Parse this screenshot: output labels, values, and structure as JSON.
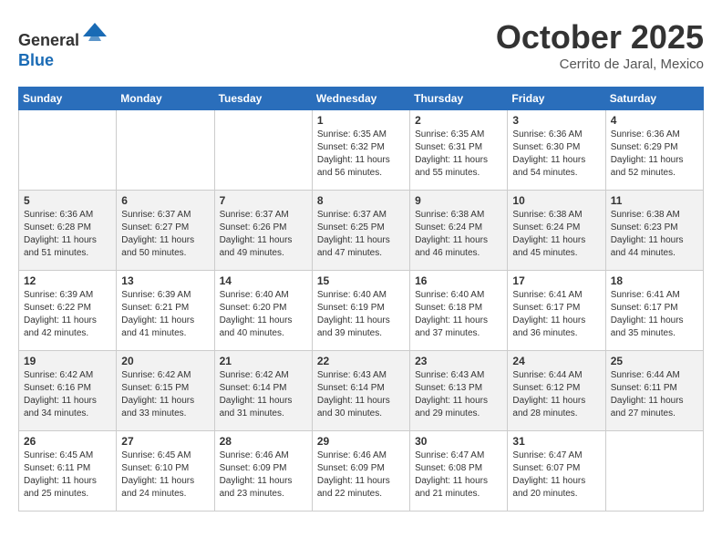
{
  "header": {
    "logo_line1": "General",
    "logo_line2": "Blue",
    "month": "October 2025",
    "location": "Cerrito de Jaral, Mexico"
  },
  "weekdays": [
    "Sunday",
    "Monday",
    "Tuesday",
    "Wednesday",
    "Thursday",
    "Friday",
    "Saturday"
  ],
  "weeks": [
    [
      {
        "day": "",
        "info": ""
      },
      {
        "day": "",
        "info": ""
      },
      {
        "day": "",
        "info": ""
      },
      {
        "day": "1",
        "info": "Sunrise: 6:35 AM\nSunset: 6:32 PM\nDaylight: 11 hours\nand 56 minutes."
      },
      {
        "day": "2",
        "info": "Sunrise: 6:35 AM\nSunset: 6:31 PM\nDaylight: 11 hours\nand 55 minutes."
      },
      {
        "day": "3",
        "info": "Sunrise: 6:36 AM\nSunset: 6:30 PM\nDaylight: 11 hours\nand 54 minutes."
      },
      {
        "day": "4",
        "info": "Sunrise: 6:36 AM\nSunset: 6:29 PM\nDaylight: 11 hours\nand 52 minutes."
      }
    ],
    [
      {
        "day": "5",
        "info": "Sunrise: 6:36 AM\nSunset: 6:28 PM\nDaylight: 11 hours\nand 51 minutes."
      },
      {
        "day": "6",
        "info": "Sunrise: 6:37 AM\nSunset: 6:27 PM\nDaylight: 11 hours\nand 50 minutes."
      },
      {
        "day": "7",
        "info": "Sunrise: 6:37 AM\nSunset: 6:26 PM\nDaylight: 11 hours\nand 49 minutes."
      },
      {
        "day": "8",
        "info": "Sunrise: 6:37 AM\nSunset: 6:25 PM\nDaylight: 11 hours\nand 47 minutes."
      },
      {
        "day": "9",
        "info": "Sunrise: 6:38 AM\nSunset: 6:24 PM\nDaylight: 11 hours\nand 46 minutes."
      },
      {
        "day": "10",
        "info": "Sunrise: 6:38 AM\nSunset: 6:24 PM\nDaylight: 11 hours\nand 45 minutes."
      },
      {
        "day": "11",
        "info": "Sunrise: 6:38 AM\nSunset: 6:23 PM\nDaylight: 11 hours\nand 44 minutes."
      }
    ],
    [
      {
        "day": "12",
        "info": "Sunrise: 6:39 AM\nSunset: 6:22 PM\nDaylight: 11 hours\nand 42 minutes."
      },
      {
        "day": "13",
        "info": "Sunrise: 6:39 AM\nSunset: 6:21 PM\nDaylight: 11 hours\nand 41 minutes."
      },
      {
        "day": "14",
        "info": "Sunrise: 6:40 AM\nSunset: 6:20 PM\nDaylight: 11 hours\nand 40 minutes."
      },
      {
        "day": "15",
        "info": "Sunrise: 6:40 AM\nSunset: 6:19 PM\nDaylight: 11 hours\nand 39 minutes."
      },
      {
        "day": "16",
        "info": "Sunrise: 6:40 AM\nSunset: 6:18 PM\nDaylight: 11 hours\nand 37 minutes."
      },
      {
        "day": "17",
        "info": "Sunrise: 6:41 AM\nSunset: 6:17 PM\nDaylight: 11 hours\nand 36 minutes."
      },
      {
        "day": "18",
        "info": "Sunrise: 6:41 AM\nSunset: 6:17 PM\nDaylight: 11 hours\nand 35 minutes."
      }
    ],
    [
      {
        "day": "19",
        "info": "Sunrise: 6:42 AM\nSunset: 6:16 PM\nDaylight: 11 hours\nand 34 minutes."
      },
      {
        "day": "20",
        "info": "Sunrise: 6:42 AM\nSunset: 6:15 PM\nDaylight: 11 hours\nand 33 minutes."
      },
      {
        "day": "21",
        "info": "Sunrise: 6:42 AM\nSunset: 6:14 PM\nDaylight: 11 hours\nand 31 minutes."
      },
      {
        "day": "22",
        "info": "Sunrise: 6:43 AM\nSunset: 6:14 PM\nDaylight: 11 hours\nand 30 minutes."
      },
      {
        "day": "23",
        "info": "Sunrise: 6:43 AM\nSunset: 6:13 PM\nDaylight: 11 hours\nand 29 minutes."
      },
      {
        "day": "24",
        "info": "Sunrise: 6:44 AM\nSunset: 6:12 PM\nDaylight: 11 hours\nand 28 minutes."
      },
      {
        "day": "25",
        "info": "Sunrise: 6:44 AM\nSunset: 6:11 PM\nDaylight: 11 hours\nand 27 minutes."
      }
    ],
    [
      {
        "day": "26",
        "info": "Sunrise: 6:45 AM\nSunset: 6:11 PM\nDaylight: 11 hours\nand 25 minutes."
      },
      {
        "day": "27",
        "info": "Sunrise: 6:45 AM\nSunset: 6:10 PM\nDaylight: 11 hours\nand 24 minutes."
      },
      {
        "day": "28",
        "info": "Sunrise: 6:46 AM\nSunset: 6:09 PM\nDaylight: 11 hours\nand 23 minutes."
      },
      {
        "day": "29",
        "info": "Sunrise: 6:46 AM\nSunset: 6:09 PM\nDaylight: 11 hours\nand 22 minutes."
      },
      {
        "day": "30",
        "info": "Sunrise: 6:47 AM\nSunset: 6:08 PM\nDaylight: 11 hours\nand 21 minutes."
      },
      {
        "day": "31",
        "info": "Sunrise: 6:47 AM\nSunset: 6:07 PM\nDaylight: 11 hours\nand 20 minutes."
      },
      {
        "day": "",
        "info": ""
      }
    ]
  ]
}
